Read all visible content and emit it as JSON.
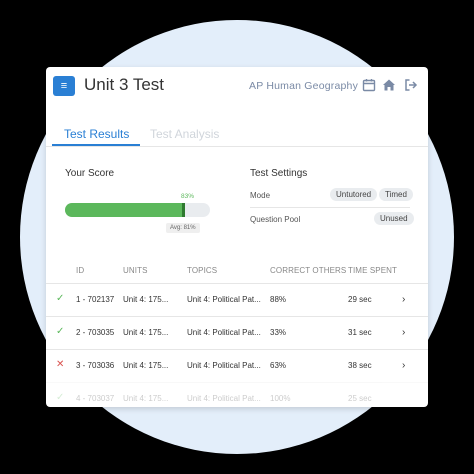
{
  "header": {
    "title": "Unit 3 Test",
    "course": "AP Human Geography",
    "menu_icon": "≡"
  },
  "tabs": [
    {
      "label": "Test Results",
      "active": true
    },
    {
      "label": "Test Analysis",
      "active": false
    }
  ],
  "score": {
    "label": "Your Score",
    "value_percent": 83,
    "value_text": "83%",
    "avg_text": "Avg: 81%"
  },
  "settings": {
    "label": "Test Settings",
    "mode_label": "Mode",
    "mode_options": [
      "Untutored",
      "Timed"
    ],
    "pool_label": "Question Pool",
    "pool_value": "Unused"
  },
  "table": {
    "headers": [
      "ID",
      "UNITS",
      "TOPICS",
      "CORRECT OTHERS",
      "TIME SPENT"
    ],
    "rows": [
      {
        "status": "correct",
        "status_glyph": "✓",
        "id": "1 - 702137",
        "units": "Unit 4: 175...",
        "topics": "Unit 4: Political Pat...",
        "correct_others": "88%",
        "time": "29 sec"
      },
      {
        "status": "correct",
        "status_glyph": "✓",
        "id": "2 - 703035",
        "units": "Unit 4: 175...",
        "topics": "Unit 4: Political Pat...",
        "correct_others": "33%",
        "time": "31 sec"
      },
      {
        "status": "incorrect",
        "status_glyph": "✕",
        "id": "3 - 703036",
        "units": "Unit 4: 175...",
        "topics": "Unit 4: Political Pat...",
        "correct_others": "63%",
        "time": "38 sec"
      },
      {
        "status": "correct",
        "status_glyph": "✓",
        "id": "4 - 703037",
        "units": "Unit 4: 175...",
        "topics": "Unit 4: Political Pat...",
        "correct_others": "100%",
        "time": "25 sec"
      }
    ]
  },
  "colors": {
    "accent": "#2a7fd4",
    "success": "#5cb85c",
    "danger": "#d9534f"
  }
}
